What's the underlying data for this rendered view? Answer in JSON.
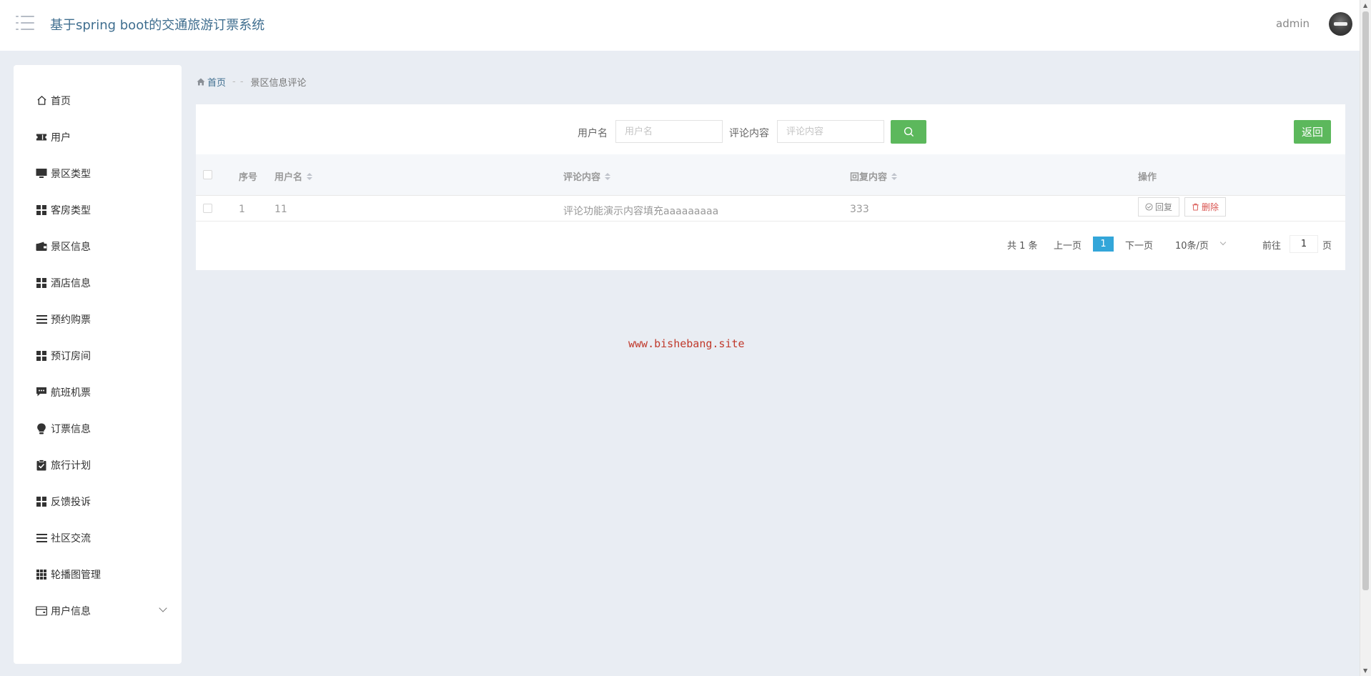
{
  "header": {
    "title": "基于spring boot的交通旅游订票系统",
    "user": "admin"
  },
  "sidebar": {
    "items": [
      {
        "label": "首页",
        "icon": "home-icon"
      },
      {
        "label": "用户",
        "icon": "ticket-icon"
      },
      {
        "label": "景区类型",
        "icon": "monitor-icon"
      },
      {
        "label": "客房类型",
        "icon": "grid-icon"
      },
      {
        "label": "景区信息",
        "icon": "wallet-icon"
      },
      {
        "label": "酒店信息",
        "icon": "grid-icon"
      },
      {
        "label": "预约购票",
        "icon": "list-icon"
      },
      {
        "label": "预订房间",
        "icon": "grid-icon"
      },
      {
        "label": "航班机票",
        "icon": "comment-icon"
      },
      {
        "label": "订票信息",
        "icon": "bulb-icon"
      },
      {
        "label": "旅行计划",
        "icon": "clipboard-icon"
      },
      {
        "label": "反馈投诉",
        "icon": "grid-icon"
      },
      {
        "label": "社区交流",
        "icon": "list-icon"
      },
      {
        "label": "轮播图管理",
        "icon": "grid9-icon"
      },
      {
        "label": "用户信息",
        "icon": "card-icon"
      }
    ]
  },
  "breadcrumb": {
    "home": "首页",
    "separator": "- -",
    "current": "景区信息评论"
  },
  "search": {
    "username_label": "用户名",
    "username_placeholder": "用户名",
    "comment_label": "评论内容",
    "comment_placeholder": "评论内容"
  },
  "back_label": "返回",
  "table": {
    "headers": {
      "index": "序号",
      "username": "用户名",
      "comment": "评论内容",
      "reply": "回复内容",
      "actions": "操作"
    },
    "rows": [
      {
        "index": "1",
        "username": "11",
        "comment": "评论功能演示内容填充aaaaaaaaa",
        "reply": "333"
      }
    ],
    "reply_btn": "回复",
    "delete_btn": "删除"
  },
  "pagination": {
    "total": "共 1 条",
    "prev": "上一页",
    "current": "1",
    "next": "下一页",
    "page_size": "10条/页",
    "goto_label": "前往",
    "goto_value": "1",
    "page_unit": "页"
  },
  "watermark": "www.bishebang.site",
  "colors": {
    "accent_green": "#5cb85c",
    "page_blue": "#33a6d9",
    "title_blue": "#3f6e8f",
    "delete_red": "#d9534f"
  }
}
